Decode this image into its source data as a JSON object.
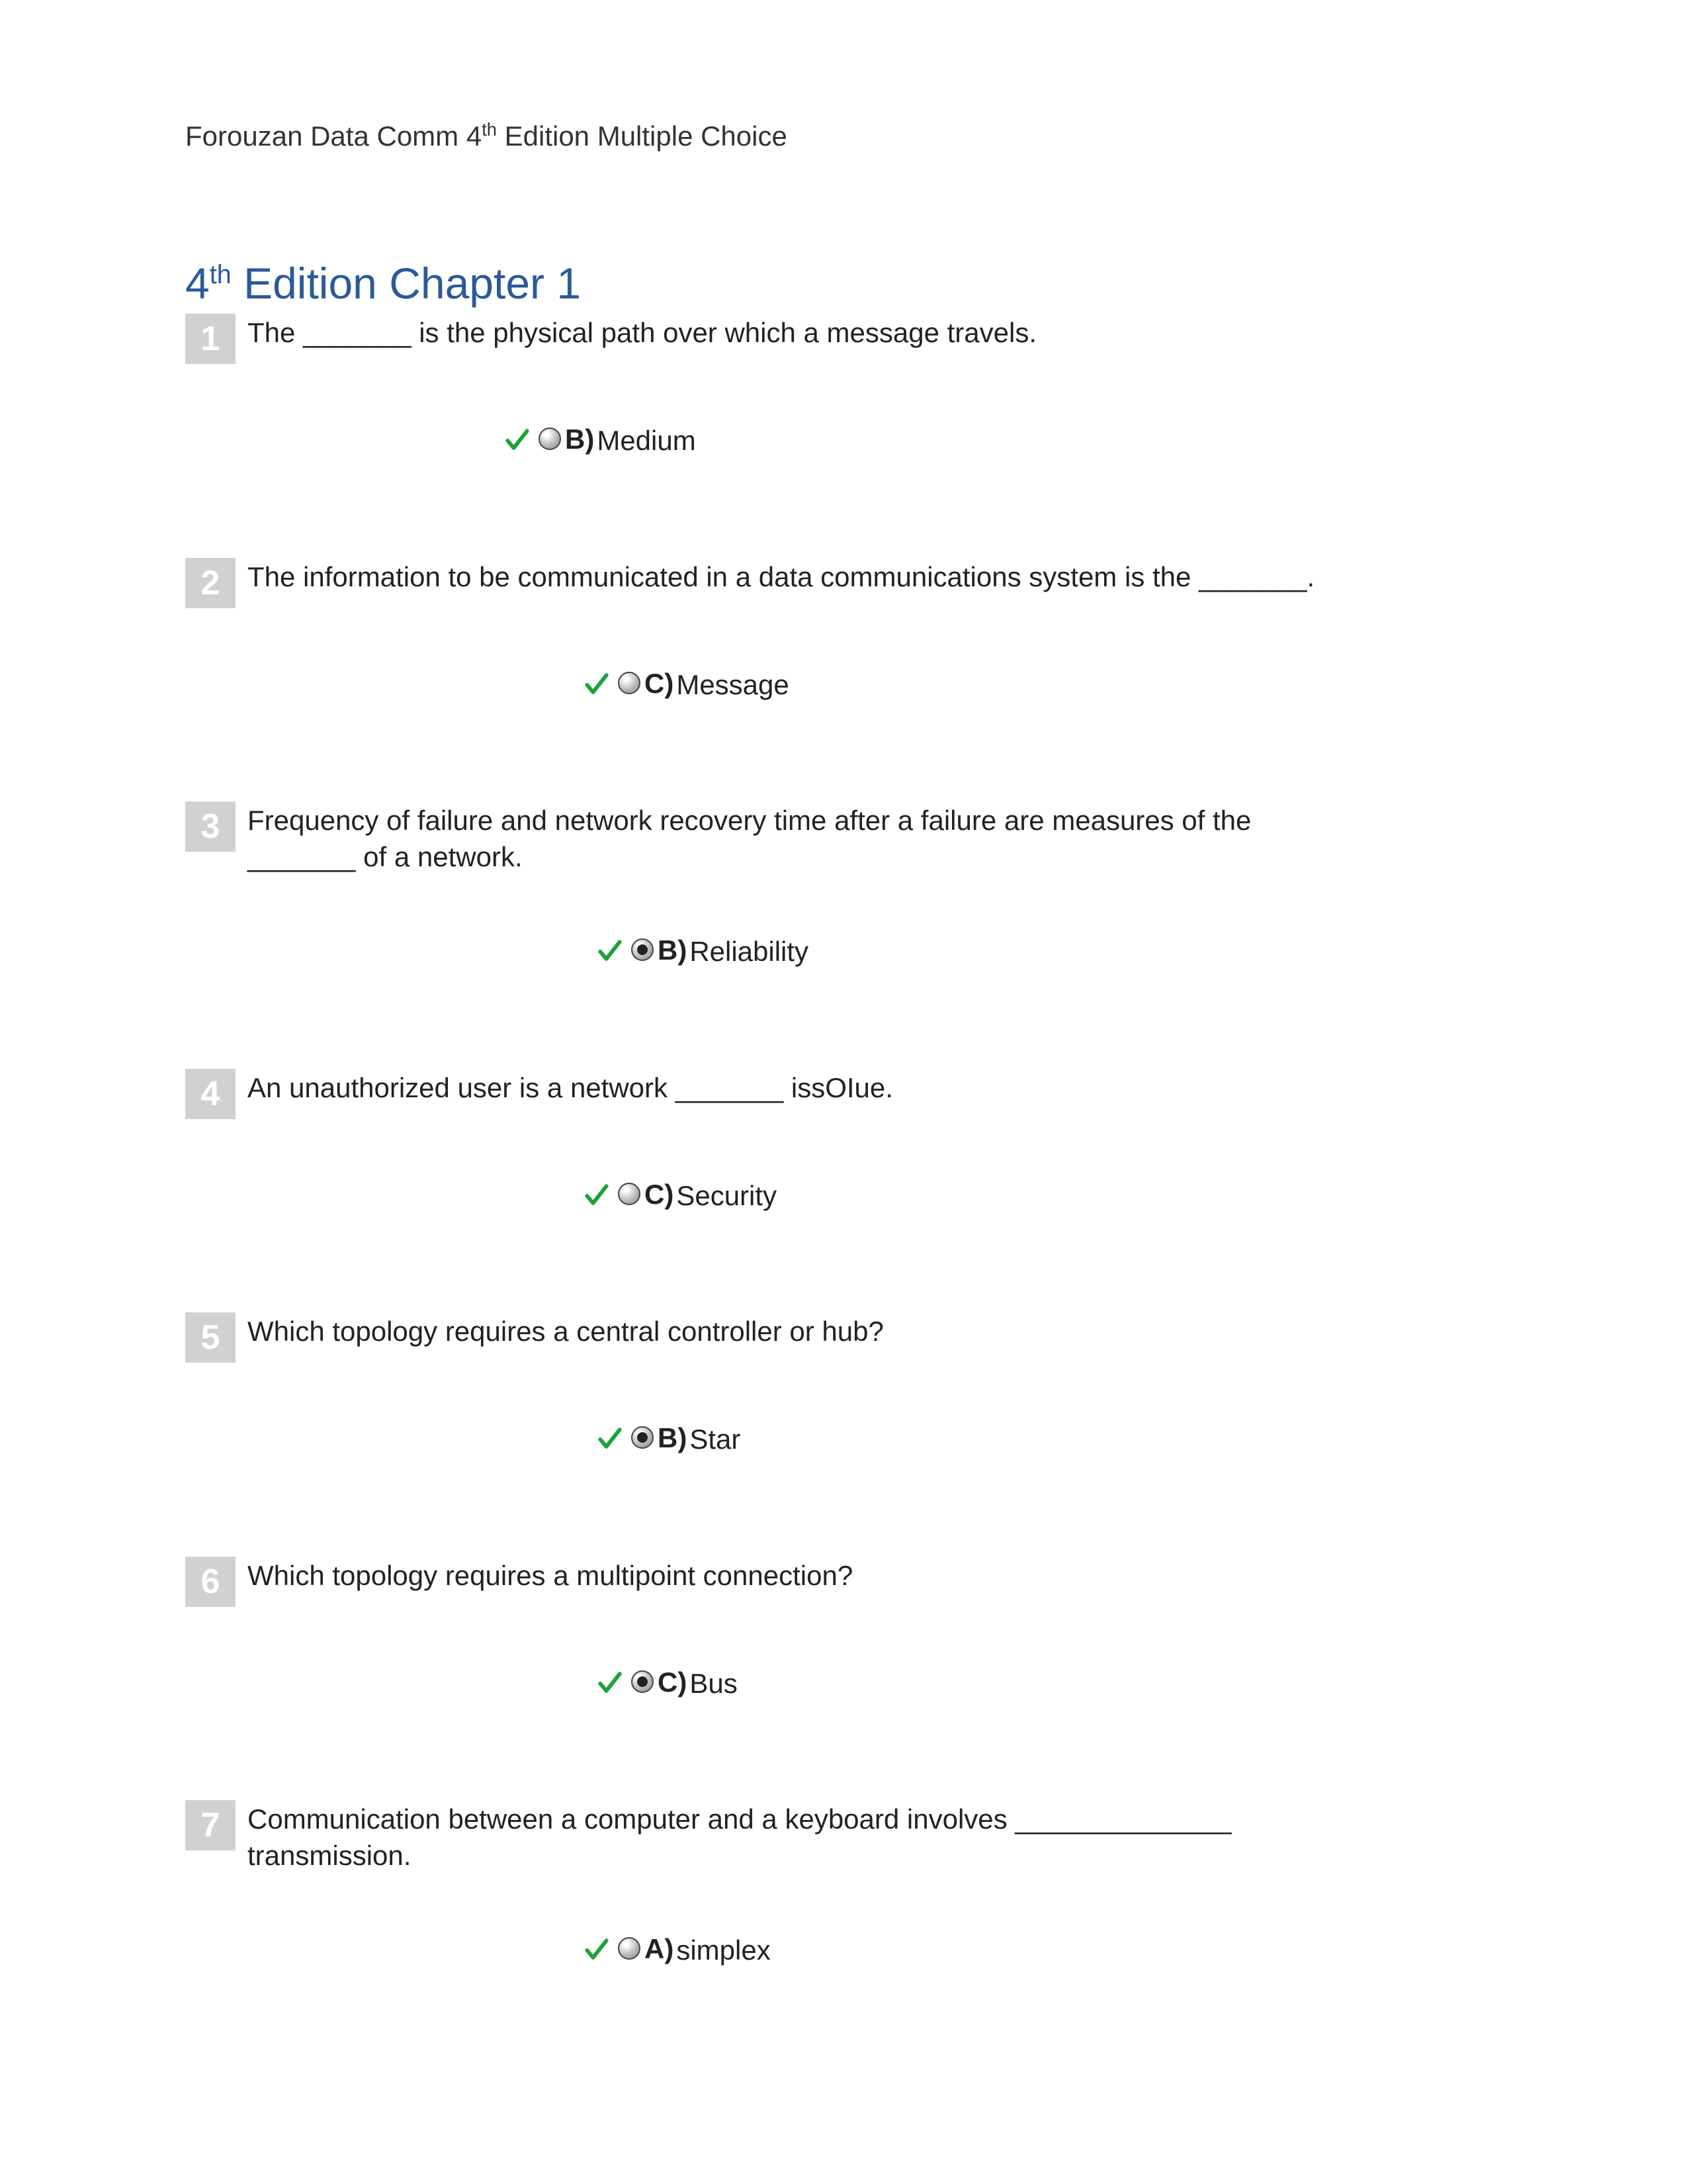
{
  "header": {
    "prefix": "Forouzan Data Comm 4",
    "sup": "th",
    "suffix": " Edition Multiple Choice"
  },
  "chapter": {
    "prefix": "4",
    "sup": "th",
    "suffix": " Edition Chapter 1"
  },
  "questions": [
    {
      "num": "1",
      "text": "The _______ is the physical path over which a message travels.",
      "answer": {
        "letter": "B)",
        "text": "Medium",
        "selected": false,
        "indent": 480,
        "wide": false
      }
    },
    {
      "num": "2",
      "text": "The information to be communicated in a data communications system is the _______.",
      "answer": {
        "letter": "C)",
        "text": "Message",
        "selected": false,
        "indent": 600,
        "wide": false
      }
    },
    {
      "num": "3",
      "text": "Frequency of failure and network recovery time after a failure are measures of the _______ of a network.",
      "answer": {
        "letter": "B)",
        "text": "Reliability",
        "selected": true,
        "indent": 620,
        "wide": false
      }
    },
    {
      "num": "4",
      "text": "An unauthorized user is a network _______ issOIue.",
      "answer": {
        "letter": "C)",
        "text": "Security",
        "selected": false,
        "indent": 600,
        "wide": true
      }
    },
    {
      "num": "5",
      "text": "Which topology requires a central controller or hub?",
      "answer": {
        "letter": "B)",
        "text": "Star",
        "selected": true,
        "indent": 620,
        "wide": true
      }
    },
    {
      "num": "6",
      "text": "Which topology requires a multipoint connection?",
      "answer": {
        "letter": "C)",
        "text": "Bus",
        "selected": true,
        "indent": 620,
        "wide": true
      }
    },
    {
      "num": "7",
      "text": "Communication between a computer and a keyboard involves ______________ transmission.",
      "answer": {
        "letter": "A)",
        "text": "simplex",
        "selected": false,
        "indent": 600,
        "wide": false
      }
    }
  ]
}
